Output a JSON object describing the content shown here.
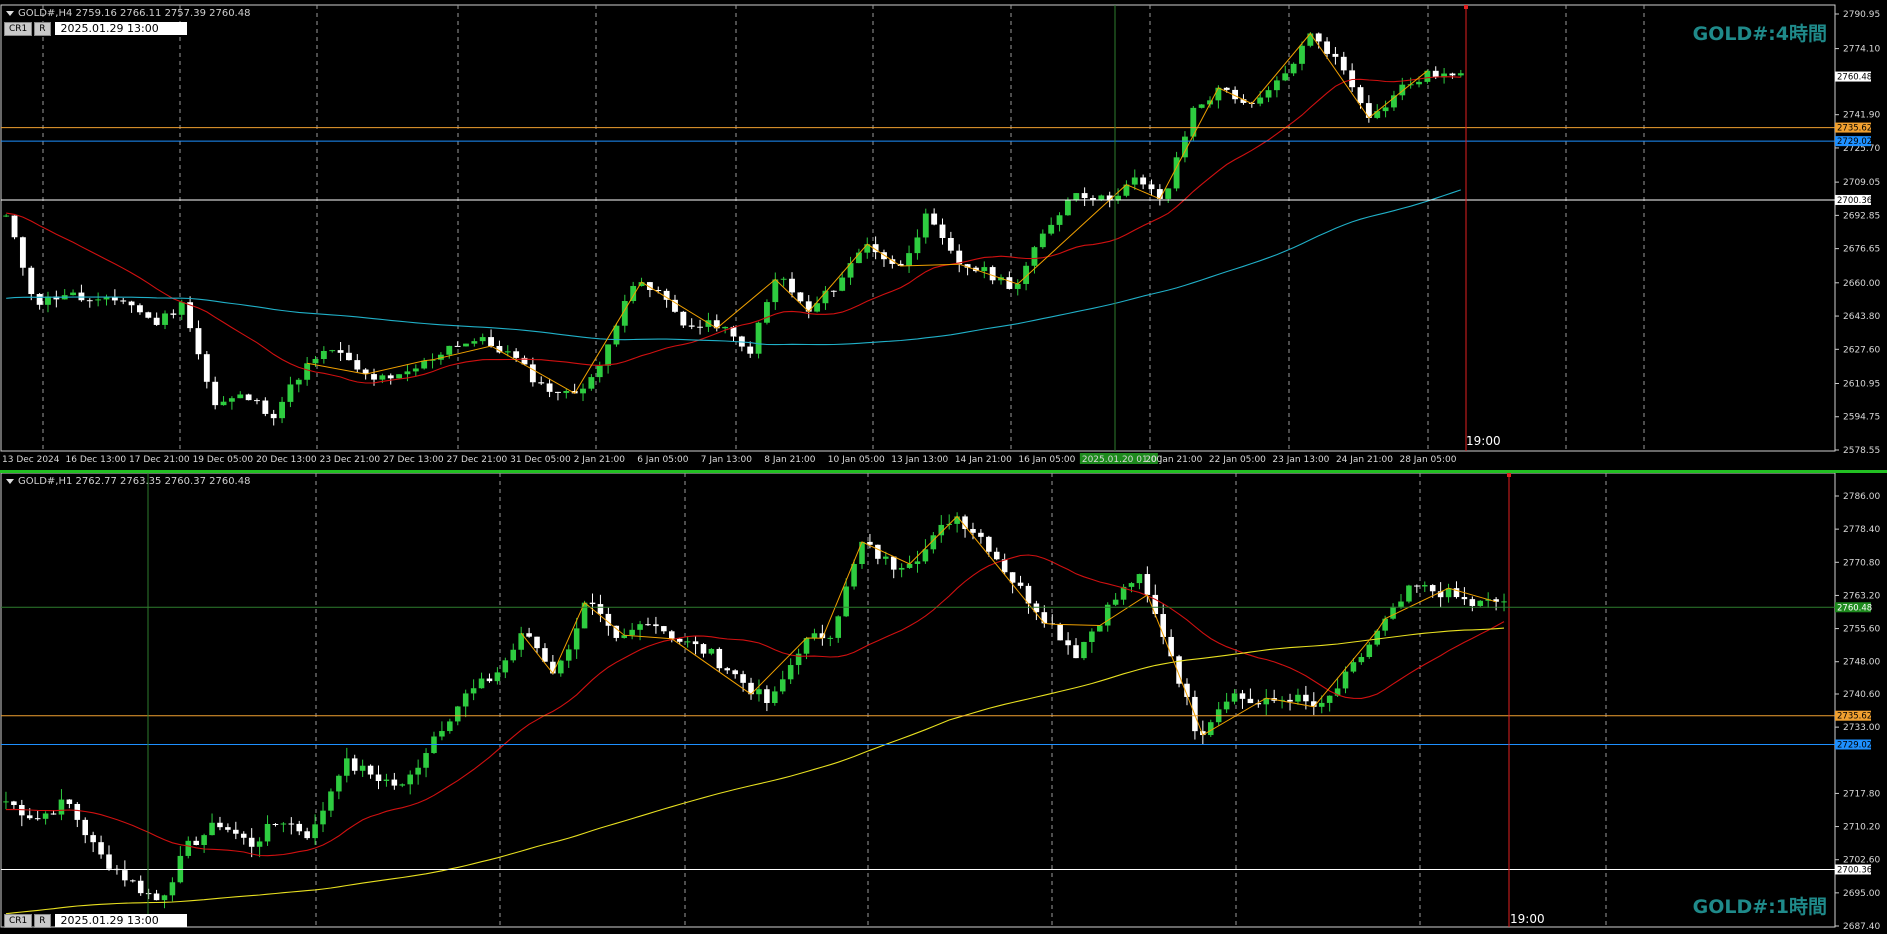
{
  "top_panel": {
    "header": "GOLD#,H4  2759.16 2766.11 2757.39 2760.48",
    "btn_cr1": "CR1",
    "btn_r": "R",
    "datetime": "2025.01.29 13:00",
    "title": "GOLD#:4時間",
    "cursor_time": "19:00",
    "vline_label": "2025.01.20 01:00"
  },
  "bottom_panel": {
    "header": "GOLD#,H1  2762.77 2763.35 2760.37 2760.48",
    "btn_cr1": "CR1",
    "btn_r": "R",
    "datetime": "2025.01.29 13:00",
    "title": "GOLD#:1時間",
    "cursor_time": "19:00"
  },
  "colors": {
    "bull": "#2ecc40",
    "bear": "#ffffff",
    "ma_red": "#d01010",
    "ma_cyan": "#20b0c8",
    "ma_yellow": "#e8e020",
    "zigzag": "#f0a000",
    "orange_level": "#f0a030",
    "blue_level": "#1e90ff",
    "white_level": "#ffffff",
    "cursor": "#e02020",
    "title": "#1f8a8a"
  },
  "chart_data": [
    {
      "type": "candlestick",
      "symbol": "GOLD#",
      "timeframe": "H4",
      "ylim": [
        2578.55,
        2790.95
      ],
      "y_ticks": [
        "2790.95",
        "2774.10",
        "2760.48",
        "2741.90",
        "2735.62",
        "2729.02",
        "2725.70",
        "2709.05",
        "2700.36",
        "2692.85",
        "2676.65",
        "2660.00",
        "2643.80",
        "2627.60",
        "2610.95",
        "2594.75",
        "2578.55"
      ],
      "x_ticks": [
        "13 Dec 2024",
        "16 Dec 13:00",
        "17 Dec 21:00",
        "19 Dec 05:00",
        "20 Dec 13:00",
        "23 Dec 21:00",
        "27 Dec 13:00",
        "27 Dec 21:00",
        "31 Dec 05:00",
        "2 Jan 21:00",
        "6 Jan 05:00",
        "7 Jan 13:00",
        "8 Jan 21:00",
        "10 Jan 05:00",
        "13 Jan 13:00",
        "14 Jan 21:00",
        "16 Jan 05:00",
        "2025.01.20 01:00",
        "20 Jan 21:00",
        "22 Jan 05:00",
        "23 Jan 13:00",
        "24 Jan 21:00",
        "28 Jan 05:00"
      ],
      "price_keypoints": [
        2692,
        2650,
        2655,
        2650,
        2652,
        2640,
        2650,
        2600,
        2605,
        2596,
        2618,
        2628,
        2615,
        2612,
        2620,
        2630,
        2632,
        2625,
        2610,
        2605,
        2618,
        2660,
        2655,
        2638,
        2640,
        2625,
        2665,
        2645,
        2660,
        2680,
        2666,
        2692,
        2670,
        2665,
        2658,
        2685,
        2705,
        2700,
        2710,
        2700,
        2745,
        2755,
        2745,
        2760,
        2782,
        2765,
        2740,
        2755,
        2762,
        2760
      ],
      "levels": [
        {
          "value": 2735.62,
          "label": "2735.62",
          "color": "orange"
        },
        {
          "value": 2729.02,
          "label": "2729.02",
          "color": "blue"
        },
        {
          "value": 2700.36,
          "label": "2700.36",
          "color": "white"
        }
      ],
      "last_price": "2760.48"
    },
    {
      "type": "candlestick",
      "symbol": "GOLD#",
      "timeframe": "H1",
      "ylim": [
        2687.4,
        2786.0
      ],
      "y_ticks": [
        "2786.00",
        "2778.40",
        "2770.80",
        "2763.20",
        "2760.48",
        "2755.60",
        "2748.00",
        "2740.60",
        "2735.62",
        "2733.00",
        "2729.02",
        "2717.80",
        "2710.20",
        "2702.60",
        "2700.36",
        "2695.00",
        "2687.40"
      ],
      "price_keypoints": [
        2716,
        2712,
        2716,
        2704,
        2698,
        2693,
        2706,
        2711,
        2706,
        2712,
        2708,
        2725,
        2722,
        2719,
        2731,
        2740,
        2745,
        2755,
        2745,
        2762,
        2752,
        2758,
        2753,
        2750,
        2744,
        2738,
        2752,
        2755,
        2775,
        2770,
        2773,
        2782,
        2776,
        2766,
        2758,
        2750,
        2760,
        2768,
        2752,
        2731,
        2741,
        2738,
        2740,
        2737,
        2746,
        2756,
        2765,
        2764,
        2761,
        2762
      ],
      "levels": [
        {
          "value": 2735.62,
          "label": "2735.62",
          "color": "orange"
        },
        {
          "value": 2729.02,
          "label": "2729.02",
          "color": "blue"
        },
        {
          "value": 2700.36,
          "label": "2700.36",
          "color": "white"
        }
      ],
      "last_price": "2760.48"
    }
  ]
}
